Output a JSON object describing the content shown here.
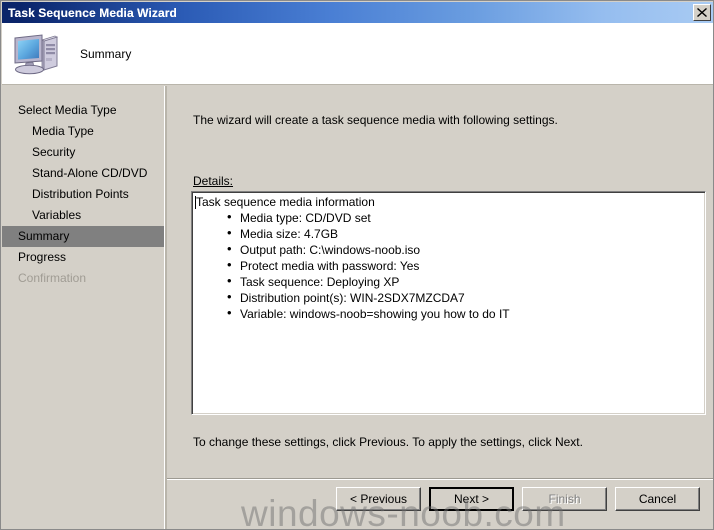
{
  "window": {
    "title": "Task Sequence Media Wizard",
    "close_label": "Close",
    "close_icon": "close-x-icon"
  },
  "header": {
    "title": "Summary",
    "icon": "computer-monitor-icon"
  },
  "sidebar": {
    "items": [
      {
        "label": "Select Media Type",
        "indent": false,
        "state": "normal"
      },
      {
        "label": "Media Type",
        "indent": true,
        "state": "normal"
      },
      {
        "label": "Security",
        "indent": true,
        "state": "normal"
      },
      {
        "label": "Stand-Alone CD/DVD",
        "indent": true,
        "state": "normal"
      },
      {
        "label": "Distribution Points",
        "indent": true,
        "state": "normal"
      },
      {
        "label": "Variables",
        "indent": true,
        "state": "normal"
      },
      {
        "label": "Summary",
        "indent": false,
        "state": "selected"
      },
      {
        "label": "Progress",
        "indent": false,
        "state": "normal"
      },
      {
        "label": "Confirmation",
        "indent": false,
        "state": "disabled"
      }
    ]
  },
  "main": {
    "intro": "The wizard will create a task sequence media with following settings.",
    "details_label": "Details:",
    "details": {
      "heading": "Task sequence media information",
      "bullets": [
        "Media type: CD/DVD set",
        "Media size: 4.7GB",
        "Output path: C:\\windows-noob.iso",
        "Protect media with password: Yes",
        "Task sequence: Deploying XP",
        "Distribution point(s): WIN-2SDX7MZCDA7",
        "Variable: windows-noob=showing you how to do IT"
      ]
    },
    "footnote": "To change these settings, click Previous. To apply the settings, click Next."
  },
  "buttons": {
    "previous": "< Previous",
    "next": "Next >",
    "finish": "Finish",
    "cancel": "Cancel"
  },
  "watermark": "windows-noob.com",
  "colors": {
    "dialog_face": "#d4d0c8",
    "title_start": "#0a246a",
    "title_end": "#a9cbf3",
    "selection": "#808080",
    "disabled_text": "#a09c94",
    "field_background": "#ffffff"
  }
}
